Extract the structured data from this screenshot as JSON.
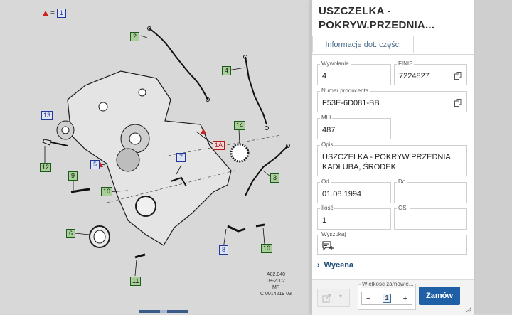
{
  "legend": {
    "text": "=",
    "ref": "1"
  },
  "callouts": [
    {
      "id": "c1",
      "text": "1",
      "style": "c-blue"
    },
    {
      "id": "c2",
      "text": "2",
      "style": "c-green"
    },
    {
      "id": "c4",
      "text": "4",
      "style": "c-green"
    },
    {
      "id": "c13",
      "text": "13",
      "style": "c-blue"
    },
    {
      "id": "c14",
      "text": "14",
      "style": "c-green"
    },
    {
      "id": "c1a",
      "text": "1A",
      "style": "c-red"
    },
    {
      "id": "c5",
      "text": "5",
      "style": "c-blue"
    },
    {
      "id": "c7",
      "text": "7",
      "style": "c-blue"
    },
    {
      "id": "c12",
      "text": "12",
      "style": "c-green"
    },
    {
      "id": "c9",
      "text": "9",
      "style": "c-green"
    },
    {
      "id": "c3",
      "text": "3",
      "style": "c-green"
    },
    {
      "id": "c10a",
      "text": "10",
      "style": "c-green"
    },
    {
      "id": "c6",
      "text": "6",
      "style": "c-green"
    },
    {
      "id": "c8",
      "text": "8",
      "style": "c-blue"
    },
    {
      "id": "c10b",
      "text": "10",
      "style": "c-green"
    },
    {
      "id": "c11",
      "text": "11",
      "style": "c-green"
    }
  ],
  "stamp": {
    "line1": "A02.040",
    "line2": "08-2002",
    "line3": "MF",
    "line4": "C 0014219 03"
  },
  "panel": {
    "title": "USZCZELKA - POKRYW.PRZEDNIA...",
    "tab": "Informacje dot. części",
    "fields": {
      "wywolanie": {
        "label": "Wywołanie",
        "value": "4"
      },
      "finis": {
        "label": "FINIS",
        "value": "7224827"
      },
      "producent": {
        "label": "Numer producenta",
        "value": "F53E-6D081-BB"
      },
      "mli": {
        "label": "MLI",
        "value": "487"
      },
      "opis": {
        "label": "Opis",
        "value": "USZCZELKA - POKRYW.PRZEDNIA KADŁUBA, ŚRODEK"
      },
      "od": {
        "label": "Od",
        "value": "01.08.1994"
      },
      "do": {
        "label": "Do",
        "value": ""
      },
      "ilosc": {
        "label": "Ilość",
        "value": "1"
      },
      "osi": {
        "label": "OSI",
        "value": ""
      },
      "wyszukaj": {
        "label": "Wyszukaj",
        "value": ""
      }
    },
    "section": "Wycena",
    "qty_label": "Wielkość zamówie...",
    "qty_minus": "−",
    "qty_value": "1",
    "qty_plus": "+",
    "order_label": "Zamów"
  }
}
